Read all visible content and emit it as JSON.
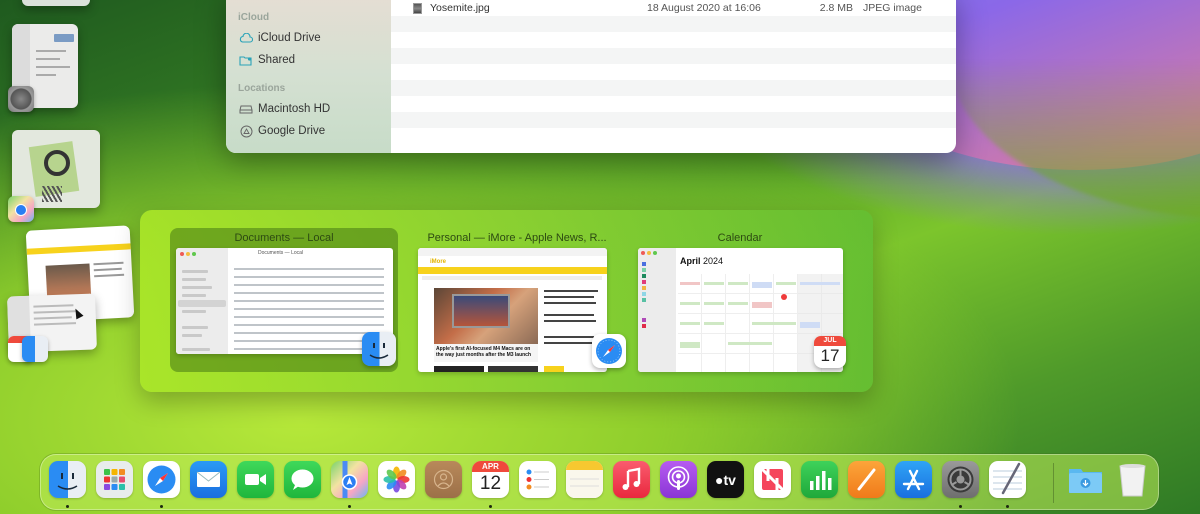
{
  "finder_window": {
    "sidebar": {
      "sections": [
        {
          "title": "iCloud",
          "items": [
            {
              "label": "iCloud Drive",
              "icon": "cloud-icon"
            },
            {
              "label": "Shared",
              "icon": "shared-folder-icon"
            }
          ]
        },
        {
          "title": "Locations",
          "items": [
            {
              "label": "Macintosh HD",
              "icon": "hard-drive-icon"
            },
            {
              "label": "Google Drive",
              "icon": "google-drive-icon"
            }
          ]
        }
      ]
    },
    "files": [
      {
        "name": "Yosemite.jpg",
        "date_modified": "18 August 2020 at 16:06",
        "size": "2.8 MB",
        "kind": "JPEG image"
      }
    ]
  },
  "app_switcher": {
    "items": [
      {
        "title": "Documents — Local",
        "app": "Finder",
        "selected": true
      },
      {
        "title": "Personal — iMore - Apple News, R...",
        "app": "Safari",
        "selected": false
      },
      {
        "title": "Calendar",
        "app": "Calendar",
        "selected": false
      }
    ],
    "finder_preview": {
      "path_title": "Documents — Local"
    },
    "calendar_preview": {
      "month_title_bold": "April",
      "month_title_year": "2024",
      "badge_month": "JUL",
      "badge_day": "17"
    },
    "safari_preview": {
      "site": "iMore",
      "headline": "Apple's first AI-focused M4 Macs are on the way just months after the M3 launch"
    }
  },
  "stage_manager": {
    "groups": [
      {
        "app": "System Settings"
      },
      {
        "app": "Maps"
      },
      {
        "app": "Safari / Finder / Calendar"
      }
    ]
  },
  "dock": {
    "items": [
      {
        "name": "Finder",
        "running": true
      },
      {
        "name": "Launchpad",
        "running": false
      },
      {
        "name": "Safari",
        "running": true
      },
      {
        "name": "Mail",
        "running": false
      },
      {
        "name": "FaceTime",
        "running": false
      },
      {
        "name": "Messages",
        "running": false
      },
      {
        "name": "Maps",
        "running": true
      },
      {
        "name": "Photos",
        "running": false
      },
      {
        "name": "Contacts",
        "running": false
      },
      {
        "name": "Calendar",
        "running": true,
        "month": "APR",
        "day": "12"
      },
      {
        "name": "Reminders",
        "running": false
      },
      {
        "name": "Notes",
        "running": false
      },
      {
        "name": "Music",
        "running": false
      },
      {
        "name": "Podcasts",
        "running": false
      },
      {
        "name": "Apple TV",
        "running": false,
        "label": "tv"
      },
      {
        "name": "News",
        "running": false
      },
      {
        "name": "Numbers",
        "running": false
      },
      {
        "name": "Pages",
        "running": false
      },
      {
        "name": "App Store",
        "running": false
      },
      {
        "name": "System Settings",
        "running": true
      },
      {
        "name": "TextEdit",
        "running": true
      },
      {
        "name": "Downloads",
        "running": false
      },
      {
        "name": "Trash",
        "running": false
      }
    ]
  }
}
